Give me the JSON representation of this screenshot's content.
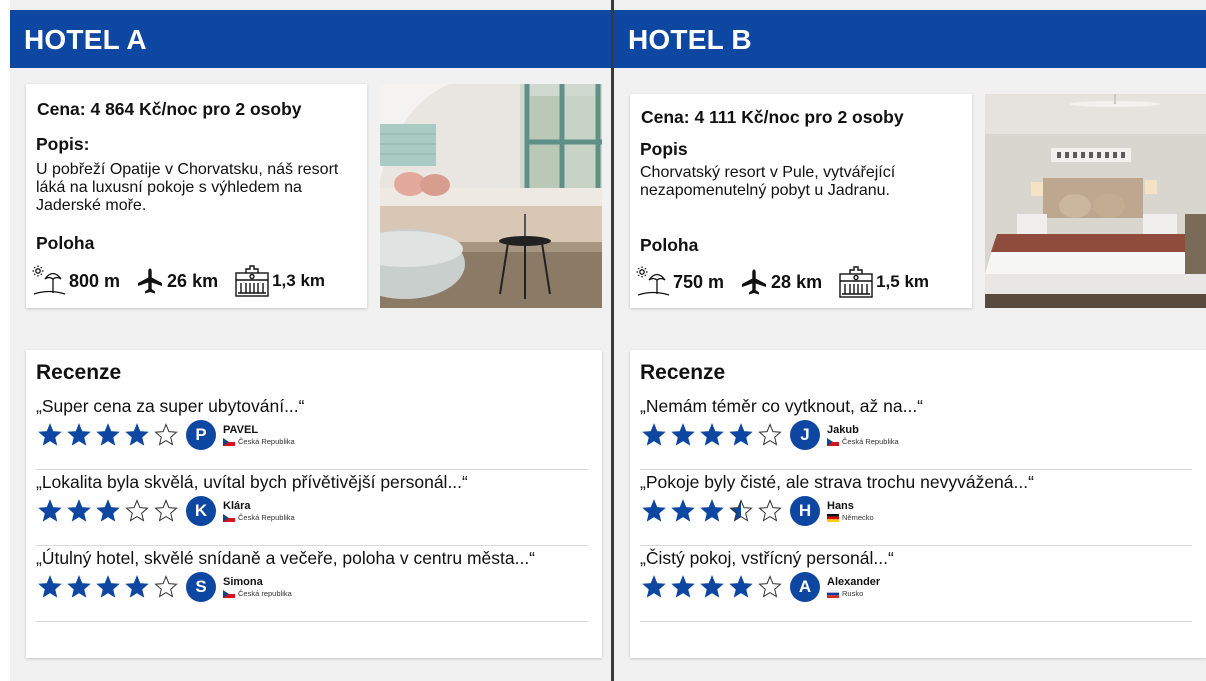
{
  "hotels": [
    {
      "title": "HOTEL A",
      "price": "Cena: 4 864 Kč/noc pro 2 osoby",
      "description_title": "Popis:",
      "description": "U pobřeží Opatije v Chorvatsku, náš resort láká na luxusní pokoje s výhledem na Jaderské moře.",
      "location_title": "Poloha",
      "locations": [
        {
          "icon": "beach-icon",
          "value": "800 m"
        },
        {
          "icon": "airplane-icon",
          "value": "26 km"
        },
        {
          "icon": "city-hall-icon",
          "value": "1,3 km"
        }
      ],
      "photo": "hotel-room-photo",
      "reviews_title": "Recenze",
      "reviews": [
        {
          "quote": "„Super cena za super ubytování...“",
          "rating": 4,
          "initial": "P",
          "name": "PAVEL",
          "country": "Česká Republika",
          "flag": "cz"
        },
        {
          "quote": "„Lokalita byla skvělá, uvítal bych přívětivější personál...“",
          "rating": 3,
          "initial": "K",
          "name": "Klára",
          "country": "Česká Republika",
          "flag": "cz"
        },
        {
          "quote": "„Útulný hotel, skvělé snídaně a večeře, poloha v centru města...“",
          "rating": 4,
          "initial": "S",
          "name": "Simona",
          "country": "Česká republika",
          "flag": "cz"
        }
      ]
    },
    {
      "title": "HOTEL B",
      "price": "Cena: 4 111 Kč/noc pro 2 osoby",
      "description_title": "Popis",
      "description": "Chorvatský resort v Pule, vytvářející nezapomenutelný pobyt u Jadranu.",
      "location_title": "Poloha",
      "locations": [
        {
          "icon": "beach-icon",
          "value": "750 m"
        },
        {
          "icon": "airplane-icon",
          "value": "28 km"
        },
        {
          "icon": "city-hall-icon",
          "value": "1,5 km"
        }
      ],
      "photo": "hotel-room-photo",
      "reviews_title": "Recenze",
      "reviews": [
        {
          "quote": "„Nemám téměr co vytknout, až na...“",
          "rating": 4,
          "initial": "J",
          "name": "Jakub",
          "country": "Česká Republika",
          "flag": "cz"
        },
        {
          "quote": "„Pokoje byly čisté, ale strava trochu nevyvážená...“",
          "rating": 3.5,
          "initial": "H",
          "name": "Hans",
          "country": "Německo",
          "flag": "de"
        },
        {
          "quote": "„Čistý pokoj, vstřícný personál...“",
          "rating": 4,
          "initial": "A",
          "name": "Alexander",
          "country": "Rusko",
          "flag": "ru"
        }
      ]
    }
  ],
  "colors": {
    "header": "#0d47a1",
    "star": "#0d47a1",
    "avatar": "#0d47a1"
  }
}
